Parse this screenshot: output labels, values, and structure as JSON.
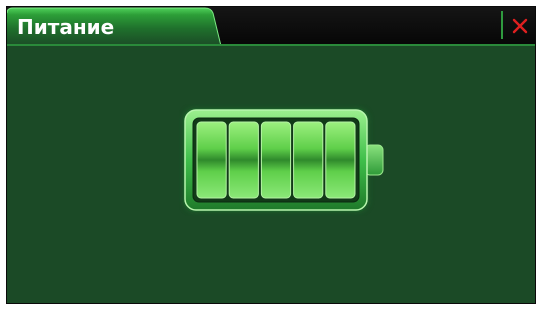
{
  "window": {
    "title": "Питание"
  },
  "titlebar": {
    "close_icon": "close-icon",
    "close_color": "#e02020"
  },
  "battery": {
    "icon": "battery-icon",
    "charge_level": 1.0,
    "segments_filled": 5,
    "segments_total": 5
  },
  "colors": {
    "background": "#1b4a26",
    "accent": "#3fbf4a",
    "titlebar": "#0b0b0b"
  }
}
